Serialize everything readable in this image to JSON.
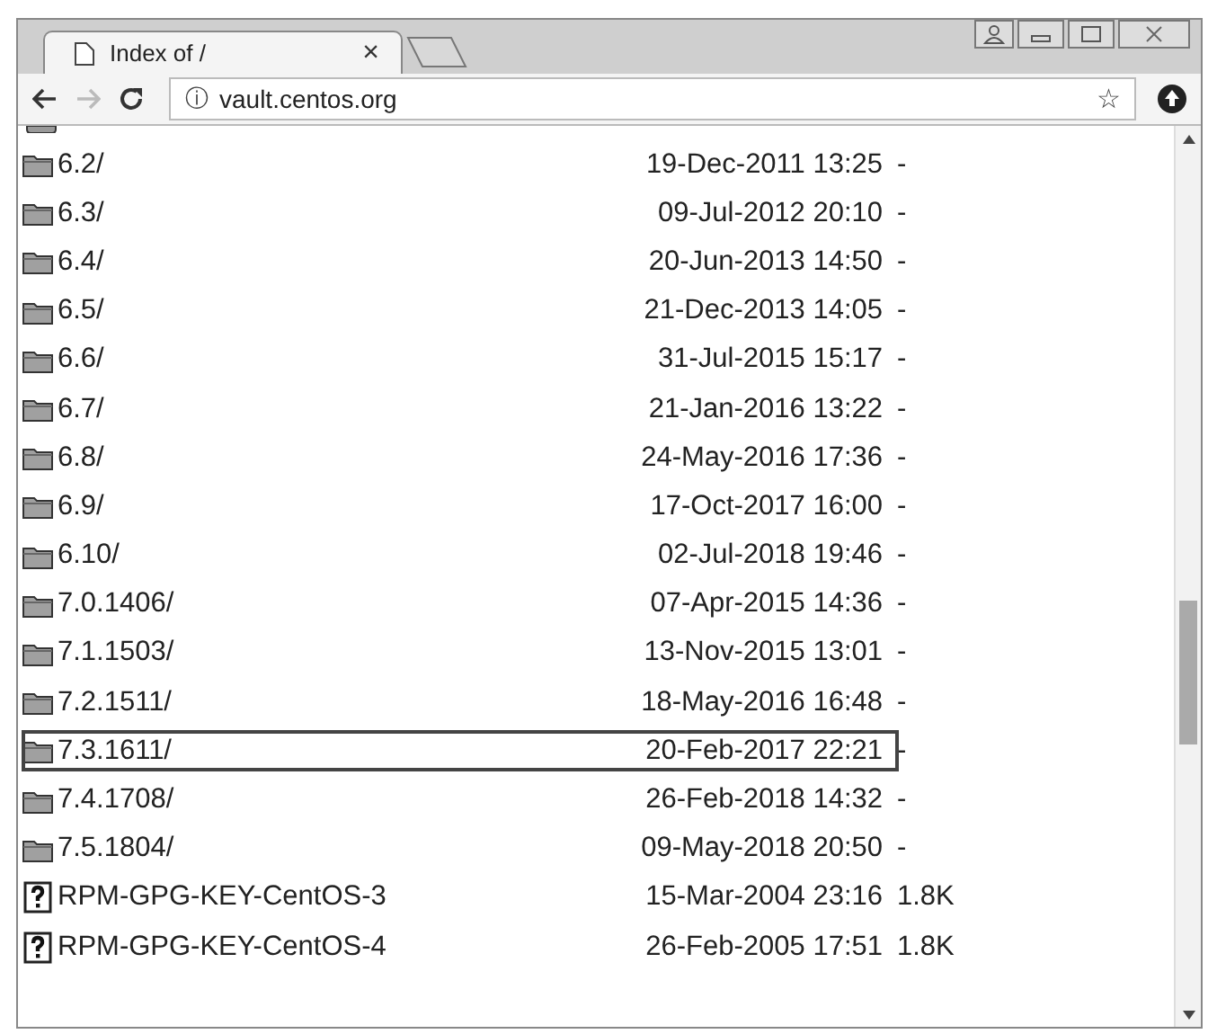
{
  "tabs": [
    {
      "title": "Index of /",
      "close": "×",
      "selected": true
    }
  ],
  "toolbar": {
    "forward_disabled": true,
    "url": "vault.centos.org",
    "info": "ⓘ",
    "star": "☆"
  },
  "listing": [
    {
      "kind": "folder",
      "name": "6.2/",
      "modified": "19-Dec-2011 13:25",
      "size": "-",
      "highlighted": false
    },
    {
      "kind": "folder",
      "name": "6.3/",
      "modified": "09-Jul-2012 20:10",
      "size": "-",
      "highlighted": false
    },
    {
      "kind": "folder",
      "name": "6.4/",
      "modified": "20-Jun-2013 14:50",
      "size": "-",
      "highlighted": false
    },
    {
      "kind": "folder",
      "name": "6.5/",
      "modified": "21-Dec-2013 14:05",
      "size": "-",
      "highlighted": false
    },
    {
      "kind": "folder",
      "name": "6.6/",
      "modified": "31-Jul-2015 15:17",
      "size": "-",
      "highlighted": false
    },
    {
      "kind": "folder",
      "name": "6.7/",
      "modified": "21-Jan-2016 13:22",
      "size": "-",
      "highlighted": false
    },
    {
      "kind": "folder",
      "name": "6.8/",
      "modified": "24-May-2016 17:36",
      "size": "-",
      "highlighted": false
    },
    {
      "kind": "folder",
      "name": "6.9/",
      "modified": "17-Oct-2017 16:00",
      "size": "-",
      "highlighted": false
    },
    {
      "kind": "folder",
      "name": "6.10/",
      "modified": "02-Jul-2018 19:46",
      "size": "-",
      "highlighted": false
    },
    {
      "kind": "folder",
      "name": "7.0.1406/",
      "modified": "07-Apr-2015 14:36",
      "size": "-",
      "highlighted": false
    },
    {
      "kind": "folder",
      "name": "7.1.1503/",
      "modified": "13-Nov-2015 13:01",
      "size": "-",
      "highlighted": false
    },
    {
      "kind": "folder",
      "name": "7.2.1511/",
      "modified": "18-May-2016 16:48",
      "size": "-",
      "highlighted": false
    },
    {
      "kind": "folder",
      "name": "7.3.1611/",
      "modified": "20-Feb-2017 22:21",
      "size": "-",
      "highlighted": true
    },
    {
      "kind": "folder",
      "name": "7.4.1708/",
      "modified": "26-Feb-2018 14:32",
      "size": "-",
      "highlighted": false
    },
    {
      "kind": "folder",
      "name": "7.5.1804/",
      "modified": "09-May-2018 20:50",
      "size": "-",
      "highlighted": false
    },
    {
      "kind": "file",
      "name": "RPM-GPG-KEY-CentOS-3",
      "modified": "15-Mar-2004 23:16",
      "size": "1.8K",
      "highlighted": false
    },
    {
      "kind": "file",
      "name": "RPM-GPG-KEY-CentOS-4",
      "modified": "26-Feb-2005 17:51",
      "size": "1.8K",
      "highlighted": false
    }
  ]
}
